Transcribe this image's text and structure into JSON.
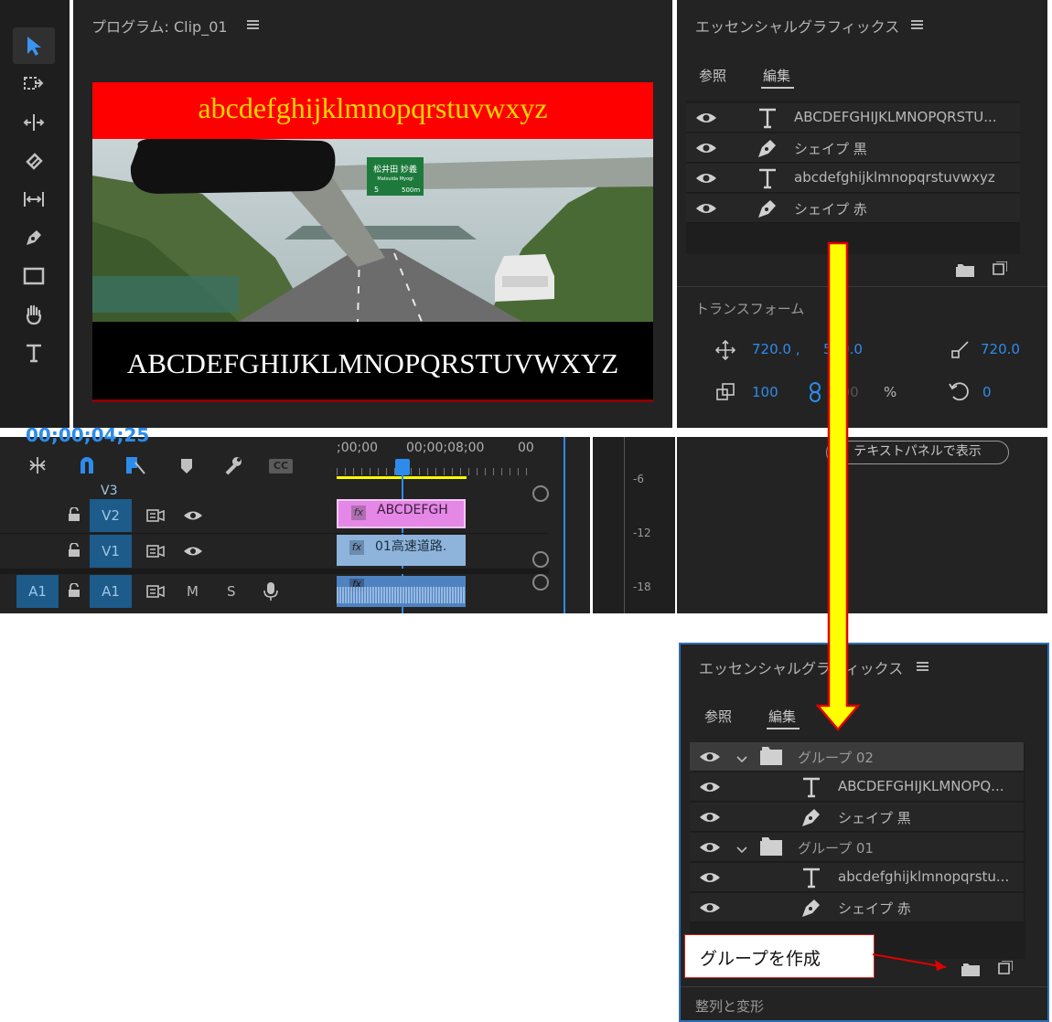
{
  "program_monitor": {
    "title": "プログラム: Clip_01",
    "top_text": "abcdefghijklmnopqrstuvwxyz",
    "bottom_text": "ABCDEFGHIJKLMNOPQRSTUVWXYZ",
    "sign_text_1": "松井田 妙義",
    "sign_text_2": "Matsuida  Myogi",
    "sign_text_3": "5",
    "sign_text_4": "500m"
  },
  "tools": [
    "selection-tool",
    "track-select-tool",
    "ripple-edit-tool",
    "razor-tool",
    "slip-tool",
    "pen-tool",
    "rectangle-tool",
    "hand-tool",
    "type-tool"
  ],
  "eg_top": {
    "title": "エッセンシャルグラフィックス",
    "tabs": [
      "参照",
      "編集"
    ],
    "layers": [
      {
        "kind": "text",
        "label": "ABCDEFGHIJKLMNOPQRSTU..."
      },
      {
        "kind": "shape",
        "label": "シェイプ 黒"
      },
      {
        "kind": "text",
        "label": "abcdefghijklmnopqrstuvwxyz"
      },
      {
        "kind": "shape",
        "label": "シェイプ 赤"
      }
    ],
    "section_transform": "トランスフォーム",
    "pos_x": "720.0 ,",
    "pos_y": "540.0",
    "anchor_x": "720.0",
    "scale": "100",
    "scale_h": "100",
    "percent": "%",
    "rotation": "0",
    "show_text_panel": "テキストパネルで表示"
  },
  "timeline": {
    "timecode": "00;00;04;25",
    "ruler_1": ";00;00",
    "ruler_2": "00;00;08;00",
    "ruler_3": "00",
    "tracks": [
      {
        "src": "",
        "name": "V2",
        "clip": "ABCDEFGH"
      },
      {
        "src": "",
        "name": "V1",
        "clip": "01高速道路."
      },
      {
        "src": "A1",
        "name": "A1",
        "m": "M",
        "s": "S",
        "clip": ""
      }
    ],
    "v3_label": "V3",
    "meter_labels": [
      "-6",
      "-12",
      "-18"
    ],
    "cc_label": "CC"
  },
  "eg_bottom": {
    "title": "エッセンシャルグラフィックス",
    "tabs": [
      "参照",
      "編集"
    ],
    "layers": [
      {
        "kind": "group",
        "label": "グループ 02"
      },
      {
        "kind": "text",
        "label": "ABCDEFGHIJKLMNOPQ..."
      },
      {
        "kind": "shape",
        "label": "シェイプ 黒"
      },
      {
        "kind": "group",
        "label": "グループ 01"
      },
      {
        "kind": "text",
        "label": "abcdefghijklmnopqrstu..."
      },
      {
        "kind": "shape",
        "label": "シェイプ 赤"
      }
    ],
    "section_align": "整列と変形"
  },
  "callout": {
    "text": "グループを作成"
  },
  "colors": {
    "accent": "#2d8ceb",
    "red_band": "#ff0000",
    "top_text": "#ffd700",
    "arrow_yellow": "#ffff00",
    "arrow_red": "#e00000"
  }
}
